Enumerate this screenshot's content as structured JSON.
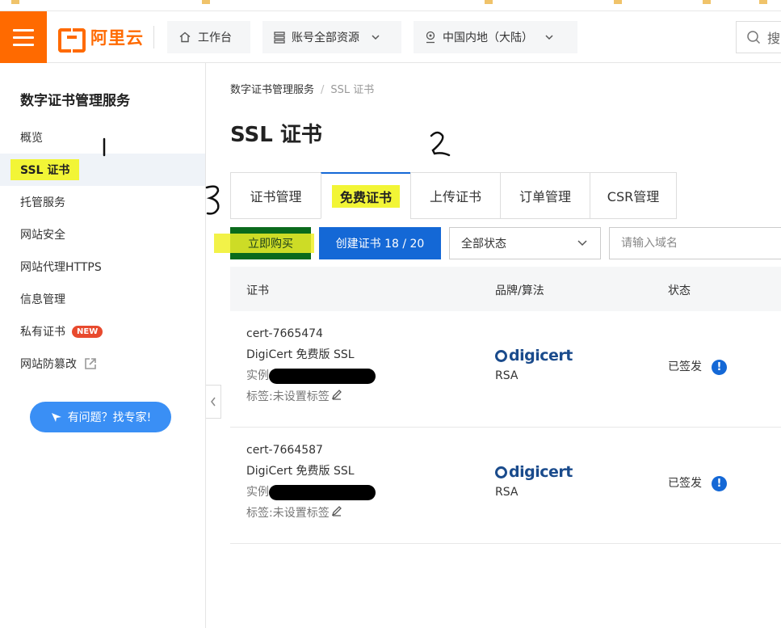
{
  "header": {
    "workbench_label": "工作台",
    "account_label": "账号全部资源",
    "region_label": "中国内地（大陆）",
    "search_placeholder": "搜",
    "logo_text": "阿里云"
  },
  "sidebar": {
    "title": "数字证书管理服务",
    "items": [
      {
        "label": "概览"
      },
      {
        "label": "SSL 证书"
      },
      {
        "label": "托管服务"
      },
      {
        "label": "网站安全"
      },
      {
        "label": "网站代理HTTPS"
      },
      {
        "label": "信息管理"
      },
      {
        "label": "私有证书",
        "badge": "NEW"
      },
      {
        "label": "网站防篡改"
      }
    ],
    "help_label": "有问题？找专家!"
  },
  "breadcrumb": {
    "root": "数字证书管理服务",
    "current": "SSL 证书"
  },
  "page_title": "SSL 证书",
  "tabs": [
    "证书管理",
    "免费证书",
    "上传证书",
    "订单管理",
    "CSR管理"
  ],
  "toolbar": {
    "buy_label": "立即购买",
    "create_label": "创建证书 18 / 20",
    "status_select": "全部状态",
    "domain_placeholder": "请输入域名"
  },
  "table": {
    "headers": [
      "证书",
      "品牌/算法",
      "状态"
    ],
    "rows": [
      {
        "cert_id": "cert-7665474",
        "cert_name": "DigiCert 免费版 SSL",
        "instance_label": "实例",
        "tag_label": "标签:未设置标签",
        "brand": "digicert",
        "algorithm": "RSA",
        "status": "已签发"
      },
      {
        "cert_id": "cert-7664587",
        "cert_name": "DigiCert 免费版 SSL",
        "instance_label": "实例",
        "tag_label": "标签:未设置标签",
        "brand": "digicert",
        "algorithm": "RSA",
        "status": "已签发"
      }
    ]
  },
  "colors": {
    "brand_orange": "#ff6a00",
    "primary_blue": "#1468d6",
    "highlight_yellow": "#f2f536",
    "help_blue": "#3a8ff5",
    "new_badge_red": "#e84a2e"
  },
  "icons": [
    "menu-icon",
    "home-icon",
    "stack-icon",
    "location-pin-icon",
    "chevron-down-icon",
    "search-icon",
    "external-link-icon",
    "bird-icon",
    "chevron-left-icon",
    "edit-icon",
    "info-icon"
  ]
}
